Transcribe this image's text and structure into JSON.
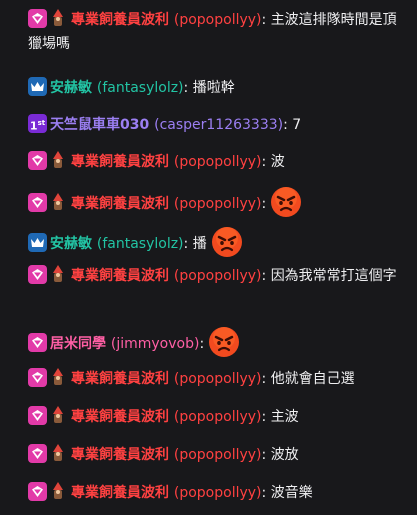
{
  "messages": [
    {
      "badge": "sub",
      "bits": true,
      "display_name": "專業飼養員波利",
      "login": "(popopollyy)",
      "text": "主波這排隊時間是頂獵場嗎",
      "emote": false,
      "color": "#ff4141"
    },
    {
      "badge": "crown",
      "bits": false,
      "display_name": "安赫敏",
      "login": "(fantasylolz)",
      "text": "播啦幹",
      "emote": false,
      "color": "#22c4a4"
    },
    {
      "badge": "first",
      "bits": false,
      "display_name": "天竺鼠車車030",
      "login": "(casper11263333)",
      "text": "7",
      "emote": false,
      "color": "#9b7ff2"
    },
    {
      "badge": "sub",
      "bits": true,
      "display_name": "專業飼養員波利",
      "login": "(popopollyy)",
      "text": "波",
      "emote": false,
      "color": "#ff4141"
    },
    {
      "badge": "sub",
      "bits": true,
      "display_name": "專業飼養員波利",
      "login": "(popopollyy)",
      "text": "",
      "emote": true,
      "color": "#ff4141"
    },
    {
      "badge": "crown",
      "bits": false,
      "display_name": "安赫敏",
      "login": "(fantasylolz)",
      "text": "播",
      "emote": true,
      "color": "#22c4a4"
    },
    {
      "badge": "sub",
      "bits": true,
      "display_name": "專業飼養員波利",
      "login": "(popopollyy)",
      "text": "因為我常常打這個字",
      "emote": false,
      "color": "#ff4141"
    },
    {
      "badge": "sub",
      "bits": false,
      "display_name": "居米同學",
      "login": "(jimmyovob)",
      "text": "",
      "emote": true,
      "color": "#ff5fa5"
    },
    {
      "badge": "sub",
      "bits": true,
      "display_name": "專業飼養員波利",
      "login": "(popopollyy)",
      "text": "他就會自己選",
      "emote": false,
      "color": "#ff4141"
    },
    {
      "badge": "sub",
      "bits": true,
      "display_name": "專業飼養員波利",
      "login": "(popopollyy)",
      "text": "主波",
      "emote": false,
      "color": "#ff4141"
    },
    {
      "badge": "sub",
      "bits": true,
      "display_name": "專業飼養員波利",
      "login": "(popopollyy)",
      "text": "波放",
      "emote": false,
      "color": "#ff4141"
    },
    {
      "badge": "sub",
      "bits": true,
      "display_name": "專業飼養員波利",
      "login": "(popopollyy)",
      "text": "波音樂",
      "emote": false,
      "color": "#ff4141"
    }
  ],
  "colon": ":",
  "first_badge_label": "1",
  "first_badge_sup": "st",
  "icons": {
    "sub": "subscriber-badge-icon",
    "crown": "vip-crown-badge-icon",
    "first": "first-badge-icon",
    "bits": "bits-gnome-icon",
    "emote": "angry-face-emote-icon"
  }
}
